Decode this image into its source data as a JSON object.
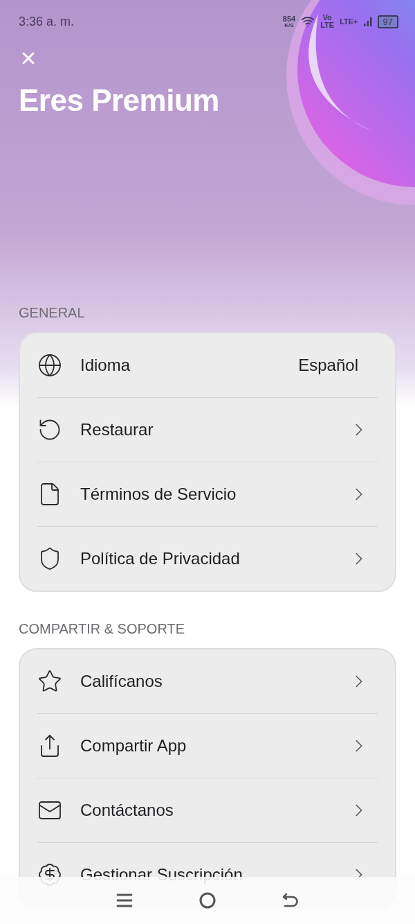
{
  "status_bar": {
    "time": "3:36 a. m.",
    "speed": "854",
    "speed_unit": "K/S",
    "volte_top": "Vo",
    "volte_bottom": "LTE",
    "network": "LTE+",
    "battery": "97"
  },
  "header": {
    "title": "Eres Premium"
  },
  "sections": [
    {
      "title": "GENERAL",
      "rows": [
        {
          "kind": "value",
          "label": "Idioma",
          "value": "Español"
        },
        {
          "kind": "link",
          "label": "Restaurar"
        },
        {
          "kind": "link",
          "label": "Términos de Servicio"
        },
        {
          "kind": "link",
          "label": "Política de Privacidad"
        }
      ]
    },
    {
      "title": "COMPARTIR & SOPORTE",
      "rows": [
        {
          "kind": "link",
          "label": "Califícanos"
        },
        {
          "kind": "link",
          "label": "Compartir App"
        },
        {
          "kind": "link",
          "label": "Contáctanos"
        },
        {
          "kind": "link",
          "label": "Gestionar Suscripción"
        }
      ]
    }
  ]
}
